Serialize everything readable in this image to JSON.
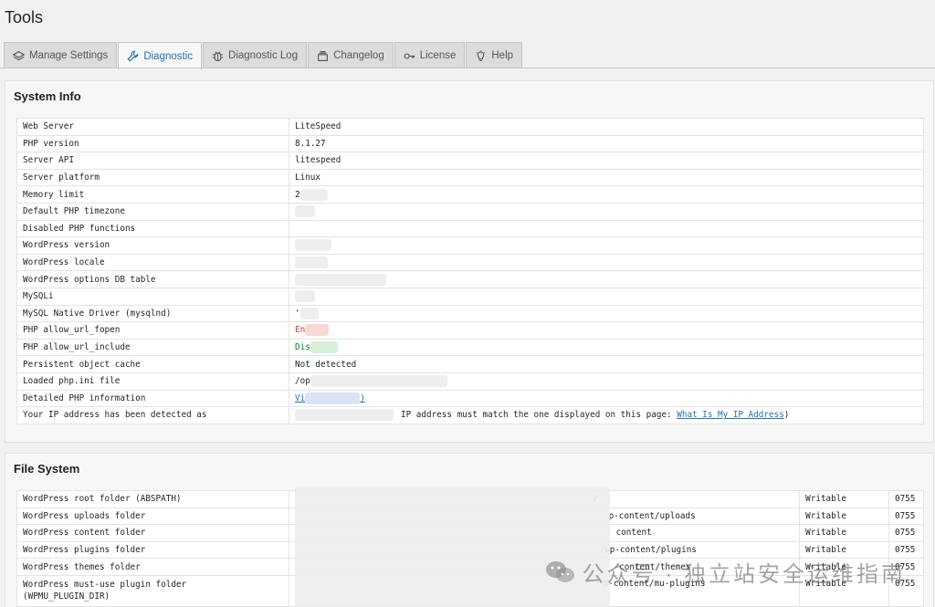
{
  "page": {
    "title": "Tools"
  },
  "tabs": [
    {
      "label": "Manage Settings",
      "icon": "layers-icon"
    },
    {
      "label": "Diagnostic",
      "icon": "wrench-icon"
    },
    {
      "label": "Diagnostic Log",
      "icon": "bug-icon"
    },
    {
      "label": "Changelog",
      "icon": "changelog-icon"
    },
    {
      "label": "License",
      "icon": "key-icon"
    },
    {
      "label": "Help",
      "icon": "lightbulb-icon"
    }
  ],
  "active_tab": "Diagnostic",
  "system_info": {
    "title": "System Info",
    "rows": [
      {
        "label": "Web Server",
        "value": "LiteSpeed"
      },
      {
        "label": "PHP version",
        "value": "8.1.27"
      },
      {
        "label": "Server API",
        "value": "litespeed"
      },
      {
        "label": "Server platform",
        "value": "Linux"
      },
      {
        "label": "Memory limit",
        "value": "2"
      },
      {
        "label": "Default PHP timezone",
        "value": ""
      },
      {
        "label": "Disabled PHP functions",
        "value": ""
      },
      {
        "label": "WordPress version",
        "value": ""
      },
      {
        "label": "WordPress locale",
        "value": ""
      },
      {
        "label": "WordPress options DB table",
        "value": ""
      },
      {
        "label": "MySQLi",
        "value": ""
      },
      {
        "label": "MySQL Native Driver (mysqlnd)",
        "value": "'"
      },
      {
        "label": "PHP allow_url_fopen",
        "value": "En"
      },
      {
        "label": "PHP allow_url_include",
        "value": "Dis"
      },
      {
        "label": "Persistent object cache",
        "value": "Not detected"
      },
      {
        "label": "Loaded php.ini file",
        "value": "/op"
      },
      {
        "label": "Detailed PHP information",
        "value": "Vi",
        "value_tail": ")"
      },
      {
        "label": "Your IP address has been detected as",
        "value": "IP address must match the one displayed on this page: ",
        "link": "What Is My IP Address",
        "value_tail": ")"
      }
    ]
  },
  "file_system": {
    "title": "File System",
    "rows": [
      {
        "label": "WordPress root folder (ABSPATH)",
        "path": "/",
        "status": "Writable",
        "perm": "0755"
      },
      {
        "label": "WordPress uploads folder",
        "path": "p-content/uploads",
        "status": "Writable",
        "perm": "0755"
      },
      {
        "label": "WordPress content folder",
        "path": "content",
        "status": "Writable",
        "perm": "0755"
      },
      {
        "label": "WordPress plugins folder",
        "path": "/wp-content/plugins",
        "status": "Writable",
        "perm": "0755"
      },
      {
        "label": "WordPress themes folder",
        "path": "-content/themes",
        "status": "Writable",
        "perm": "0755"
      },
      {
        "label": "WordPress must-use plugin folder",
        "label_line2": "(WPMU_PLUGIN_DIR)",
        "path": "b-content/mu-plugins",
        "status": "Writable",
        "perm": "0755"
      }
    ]
  },
  "watermark": {
    "text": "公众号 · 独立站安全运维指南",
    "icon": "wechat-logo-icon"
  }
}
